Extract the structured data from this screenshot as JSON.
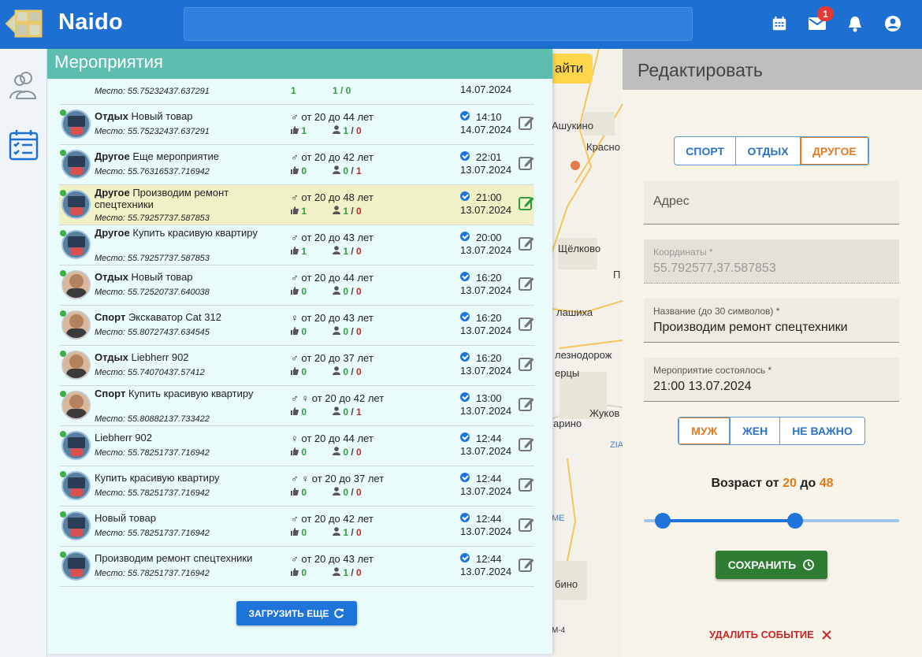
{
  "header": {
    "brand": "Naido",
    "mail_badge": "1"
  },
  "icons": {
    "calendar": "calendar-icon",
    "mail": "mail-icon",
    "bell": "bell-icon",
    "account": "account-icon",
    "people": "people-icon",
    "events": "events-list-icon",
    "edit": "edit-icon",
    "refresh": "refresh-icon",
    "save": "save-clock-icon",
    "close": "close-icon"
  },
  "map": {
    "button_label": "айти",
    "labels": [
      "Ашукино",
      "Красно",
      "Щёлково",
      "П",
      "лашиха",
      "лезнодорож",
      "ерцы",
      "Жуков",
      "арино",
      "ZIA",
      "ME",
      "бино",
      "М-4"
    ]
  },
  "events_panel": {
    "title": "Мероприятия",
    "partial_row": {
      "place": "Место: 55.75232437.637291",
      "likes": "1",
      "people": "1 / 0",
      "date": "14.07.2024"
    },
    "rows": [
      {
        "category": "Отдых",
        "name": "Новый товар",
        "place": "Место: 55.75232437.637291",
        "age": "от 20 до 44 лет",
        "gender": "♂",
        "likes": "1",
        "people_ok": "1",
        "people_bad": "0",
        "time": "14:10",
        "date": "14.07.2024",
        "avatar": "device"
      },
      {
        "category": "Другое",
        "name": "Еще мероприятие",
        "place": "Место: 55.76316537.716942",
        "age": "от 20 до 42 лет",
        "gender": "♂",
        "likes": "0",
        "people_ok": "0",
        "people_bad": "1",
        "time": "22:01",
        "date": "13.07.2024",
        "avatar": "device"
      },
      {
        "category": "Другое",
        "name": "Производим ремонт спецтехники",
        "place": "Место: 55.79257737.587853",
        "age": "от 20 до 48 лет",
        "gender": "♂",
        "likes": "1",
        "people_ok": "1",
        "people_bad": "0",
        "time": "21:00",
        "date": "13.07.2024",
        "avatar": "device",
        "active": true
      },
      {
        "category": "Другое",
        "name": "Купить красивую квартиру",
        "place": "Место: 55.79257737.587853",
        "age": "от 20 до 43 лет",
        "gender": "♂",
        "likes": "1",
        "people_ok": "1",
        "people_bad": "0",
        "time": "20:00",
        "date": "13.07.2024",
        "avatar": "device"
      },
      {
        "category": "Отдых",
        "name": "Новый товар",
        "place": "Место: 55.72520737.640038",
        "age": "от 20 до 44 лет",
        "gender": "♂",
        "likes": "0",
        "people_ok": "0",
        "people_bad": "0",
        "time": "16:20",
        "date": "13.07.2024",
        "avatar": "person"
      },
      {
        "category": "Спорт",
        "name": "Экскаватор Cat 312",
        "place": "Место: 55.80727437.634545",
        "age": "от 20 до 43 лет",
        "gender": "♀",
        "likes": "0",
        "people_ok": "0",
        "people_bad": "0",
        "time": "16:20",
        "date": "13.07.2024",
        "avatar": "person"
      },
      {
        "category": "Отдых",
        "name": "Liebherr 902",
        "place": "Место: 55.74070437.57412",
        "age": "от 20 до 37 лет",
        "gender": "♂",
        "likes": "0",
        "people_ok": "0",
        "people_bad": "0",
        "time": "16:20",
        "date": "13.07.2024",
        "avatar": "person"
      },
      {
        "category": "Спорт",
        "name": "Купить красивую квартиру",
        "place": "Место: 55.80882137.733422",
        "age": "от 20 до 42 лет",
        "gender": "♂ ♀",
        "likes": "0",
        "people_ok": "0",
        "people_bad": "1",
        "time": "13:00",
        "date": "13.07.2024",
        "avatar": "person"
      },
      {
        "category": "",
        "name": "Liebherr 902",
        "place": "Место: 55.78251737.716942",
        "age": "от 20 до 44 лет",
        "gender": "♀",
        "likes": "0",
        "people_ok": "0",
        "people_bad": "0",
        "time": "12:44",
        "date": "13.07.2024",
        "avatar": "device"
      },
      {
        "category": "",
        "name": "Купить красивую квартиру",
        "place": "Место: 55.78251737.716942",
        "age": "от 20 до 37 лет",
        "gender": "♂ ♀",
        "likes": "0",
        "people_ok": "0",
        "people_bad": "0",
        "time": "12:44",
        "date": "13.07.2024",
        "avatar": "device"
      },
      {
        "category": "",
        "name": "Новый товар",
        "place": "Место: 55.78251737.716942",
        "age": "от 20 до 42 лет",
        "gender": "♂",
        "likes": "0",
        "people_ok": "1",
        "people_bad": "0",
        "time": "12:44",
        "date": "13.07.2024",
        "avatar": "device"
      },
      {
        "category": "",
        "name": "Производим ремонт спецтехники",
        "place": "Место: 55.78251737.716942",
        "age": "от 20 до 43 лет",
        "gender": "♂",
        "likes": "0",
        "people_ok": "1",
        "people_bad": "0",
        "time": "12:44",
        "date": "13.07.2024",
        "avatar": "device"
      }
    ],
    "load_more": "ЗАГРУЗИТЬ ЕЩЕ"
  },
  "edit_panel": {
    "title": "Редактировать",
    "categories": [
      "СПОРТ",
      "ОТДЫХ",
      "ДРУГОЕ"
    ],
    "selected_category": "ДРУГОЕ",
    "address_placeholder": "Адрес",
    "coords_label": "Координаты *",
    "coords_value": "55.792577,37.587853",
    "name_label": "Название (до 30 символов) *",
    "name_value": "Производим ремонт спецтехники",
    "date_label": "Мероприятие состоялось *",
    "date_value": "21:00 13.07.2024",
    "genders": [
      "МУЖ",
      "ЖЕН",
      "НЕ ВАЖНО"
    ],
    "selected_gender": "МУЖ",
    "age_prefix": "Возраст от",
    "age_mid": "до",
    "age_from": "20",
    "age_to": "48",
    "age_min": 18,
    "age_max": 60,
    "save_label": "СОХРАНИТЬ",
    "delete_label": "УДАЛИТЬ СОБЫТИЕ"
  },
  "colors": {
    "primary": "#1d6fd1",
    "accent": "#e07a1f",
    "teal_header": "#5dbeb0",
    "save_green": "#2e7d32",
    "danger": "#c62828"
  }
}
